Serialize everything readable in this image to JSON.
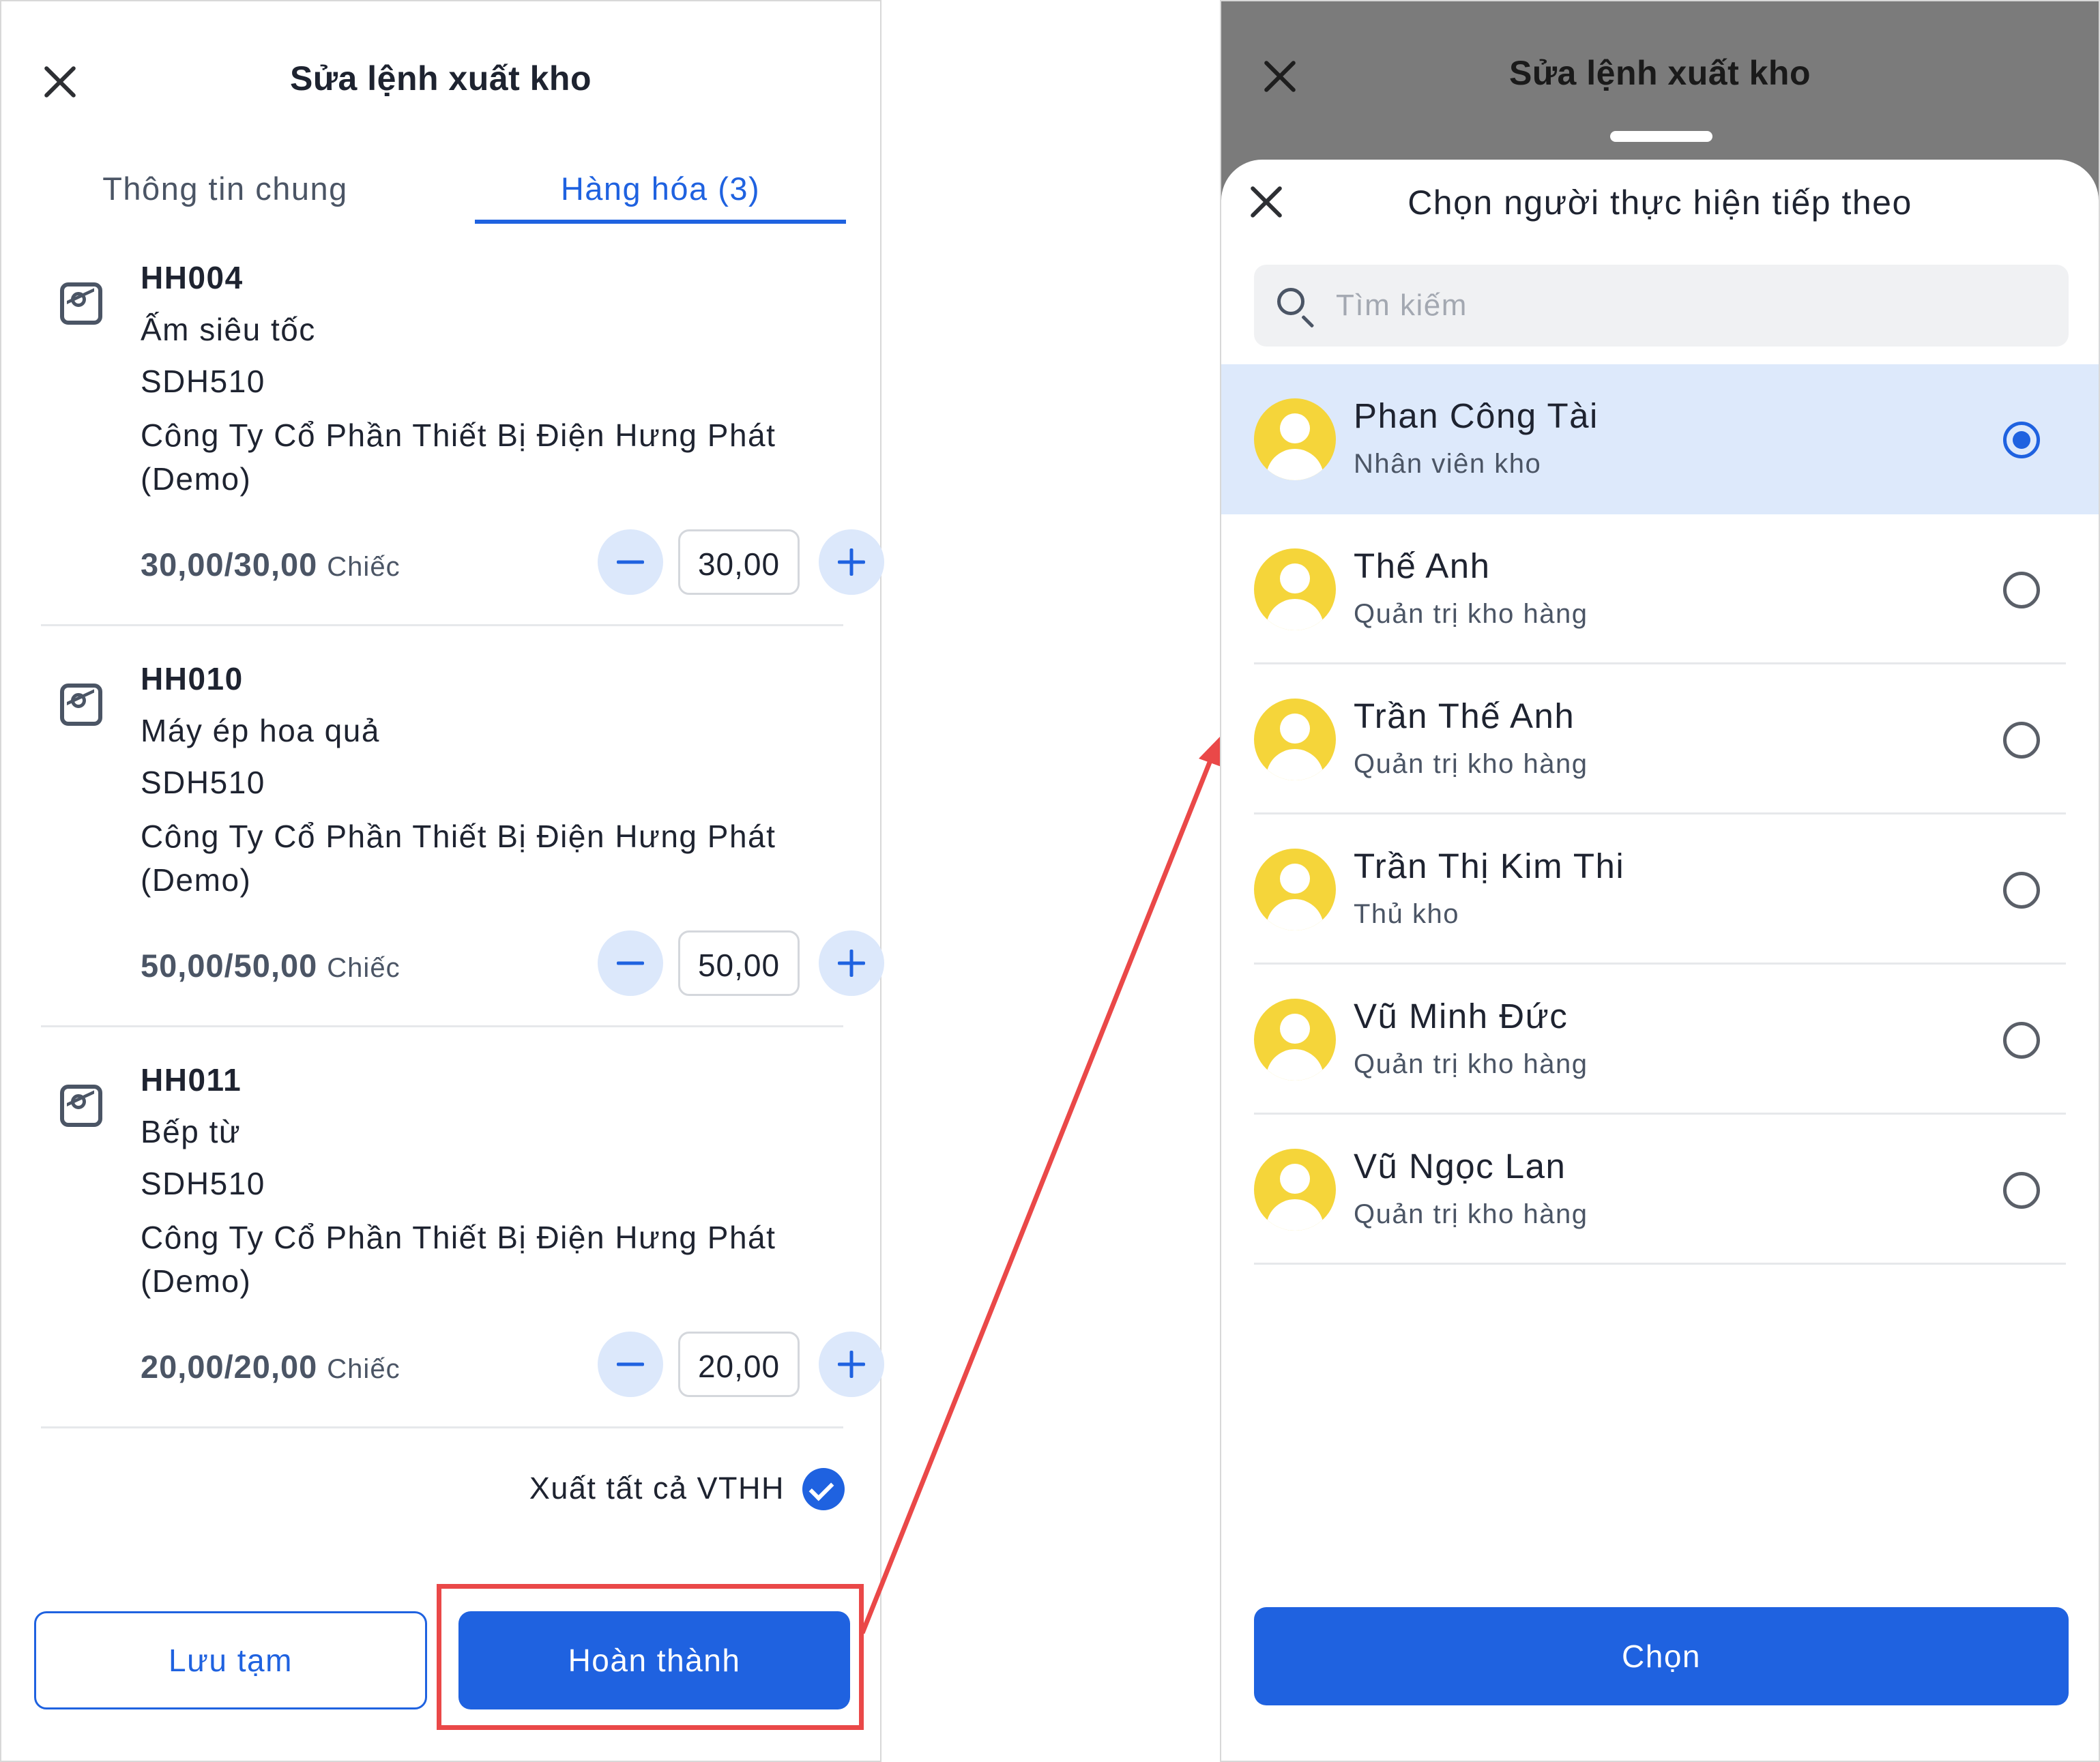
{
  "left_screen": {
    "title": "Sửa lệnh xuất kho",
    "tabs": [
      {
        "label": "Thông tin chung",
        "active": false
      },
      {
        "label": "Hàng hóa (3)",
        "active": true
      }
    ],
    "items": [
      {
        "code": "HH004",
        "name": "Ấm siêu tốc",
        "sdh": "SDH510",
        "company": "Công Ty Cổ Phần Thiết Bị Điện Hưng Phát (Demo)",
        "quantity_text": "30,00/30,00",
        "unit": "Chiếc",
        "input_value": "30,00"
      },
      {
        "code": "HH010",
        "name": "Máy ép hoa quả",
        "sdh": "SDH510",
        "company": "Công Ty Cổ Phần Thiết Bị Điện Hưng Phát (Demo)",
        "quantity_text": "50,00/50,00",
        "unit": "Chiếc",
        "input_value": "50,00"
      },
      {
        "code": "HH011",
        "name": "Bếp từ",
        "sdh": "SDH510",
        "company": "Công Ty Cổ Phần Thiết Bị Điện Hưng Phát (Demo)",
        "quantity_text": "20,00/20,00",
        "unit": "Chiếc",
        "input_value": "20,00"
      }
    ],
    "export_all_label": "Xuất tất cả VTHH",
    "export_all_checked": true,
    "save_label": "Lưu tạm",
    "finish_label": "Hoàn thành"
  },
  "right_screen": {
    "background_title": "Sửa lệnh xuất kho",
    "sheet_title": "Chọn người thực hiện tiếp theo",
    "search_placeholder": "Tìm kiếm",
    "people": [
      {
        "name": "Phan Công Tài",
        "role": "Nhân viên kho",
        "selected": true
      },
      {
        "name": "Thế Anh",
        "role": "Quản trị kho hàng",
        "selected": false
      },
      {
        "name": "Trần Thế Anh",
        "role": "Quản trị kho hàng",
        "selected": false
      },
      {
        "name": "Trần Thị Kim Thi",
        "role": "Thủ kho",
        "selected": false
      },
      {
        "name": "Vũ Minh Đức",
        "role": "Quản trị kho hàng",
        "selected": false
      },
      {
        "name": "Vũ Ngọc Lan",
        "role": "Quản trị kho hàng",
        "selected": false
      }
    ],
    "choose_label": "Chọn"
  },
  "colors": {
    "primary": "#1f62e0",
    "highlight": "#ea4848",
    "avatar": "#f5d53a",
    "selected_row": "#dde9fb"
  },
  "icons": [
    "close-icon",
    "image-icon",
    "minus-icon",
    "plus-icon",
    "check-icon",
    "search-icon",
    "avatar-icon",
    "radio-icon"
  ]
}
